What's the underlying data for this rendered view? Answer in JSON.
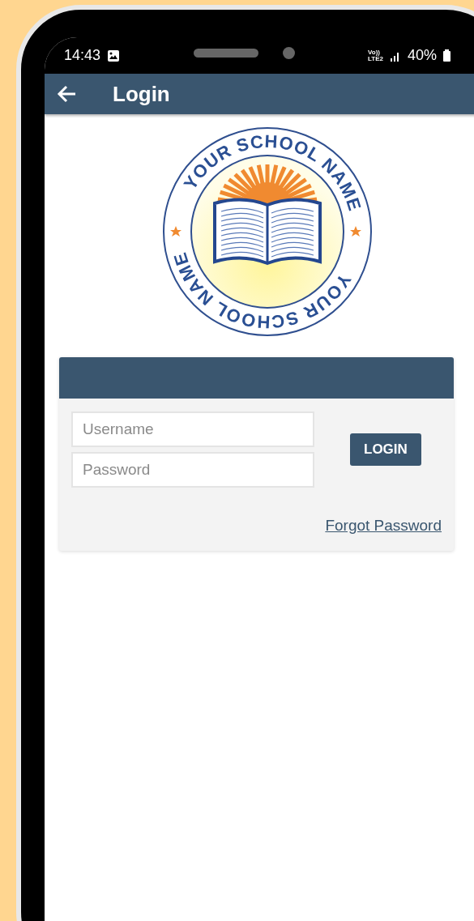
{
  "status_bar": {
    "time": "14:43",
    "network": [
      "Vo))",
      "LTE2"
    ],
    "battery": "40%"
  },
  "app_bar": {
    "title": "Login"
  },
  "logo": {
    "school_name_top": "YOUR SCHOOL NAME",
    "school_name_bottom": "YOUR SCHOOL NAME"
  },
  "login_form": {
    "fields": [
      {
        "placeholder": "Username"
      },
      {
        "placeholder": "Password"
      }
    ],
    "button": "LOGIN",
    "link": "Forgot Password"
  }
}
